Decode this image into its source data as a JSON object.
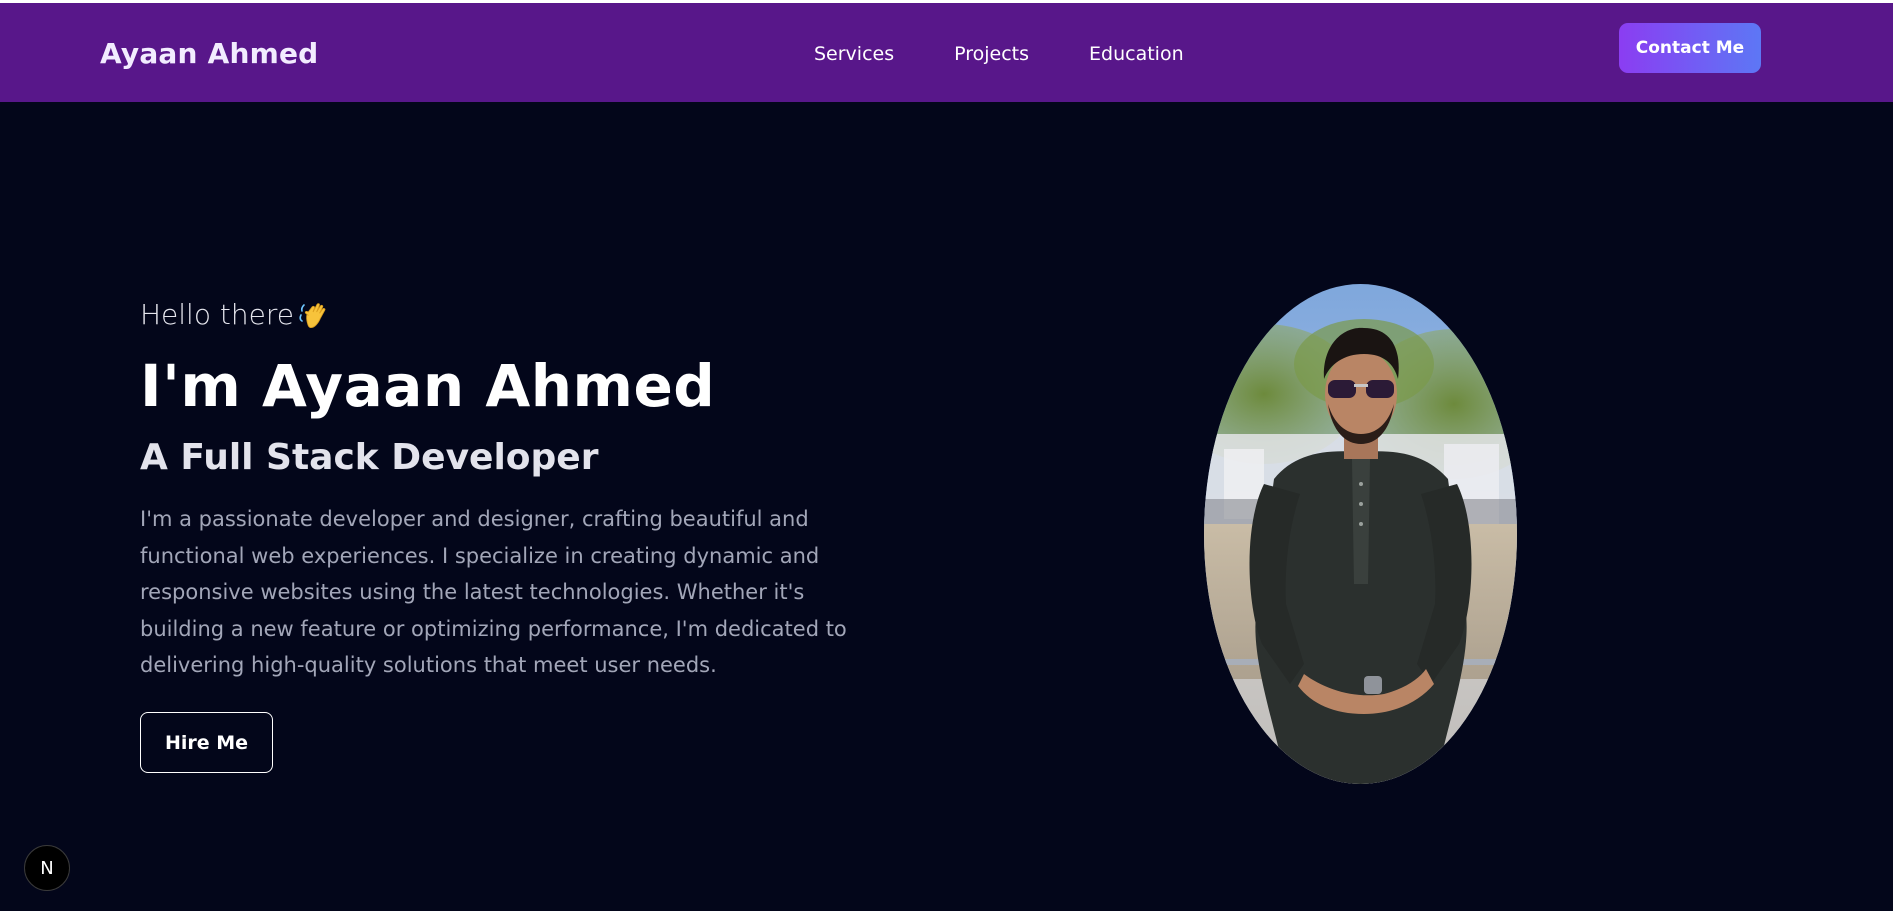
{
  "header": {
    "brand": "Ayaan Ahmed",
    "nav": [
      {
        "label": "Services"
      },
      {
        "label": "Projects"
      },
      {
        "label": "Education"
      }
    ],
    "cta_label": "Contact Me"
  },
  "hero": {
    "greeting": "Hello there",
    "greeting_icon": "waving-hand-icon",
    "name": "I'm Ayaan Ahmed",
    "role": "A Full Stack Developer",
    "bio": "I'm a passionate developer and designer, crafting beautiful and functional web experiences. I specialize in creating dynamic and responsive websites using the latest technologies. Whether it's building a new feature or optimizing performance, I'm dedicated to delivering high-quality solutions that meet user needs.",
    "cta_label": "Hire Me"
  },
  "dev_badge": {
    "label": "N"
  },
  "colors": {
    "navbar_bg": "#58178a",
    "page_bg": "#03061a",
    "contact_gradient_start": "#8b3df2",
    "contact_gradient_end": "#5d77f5"
  }
}
